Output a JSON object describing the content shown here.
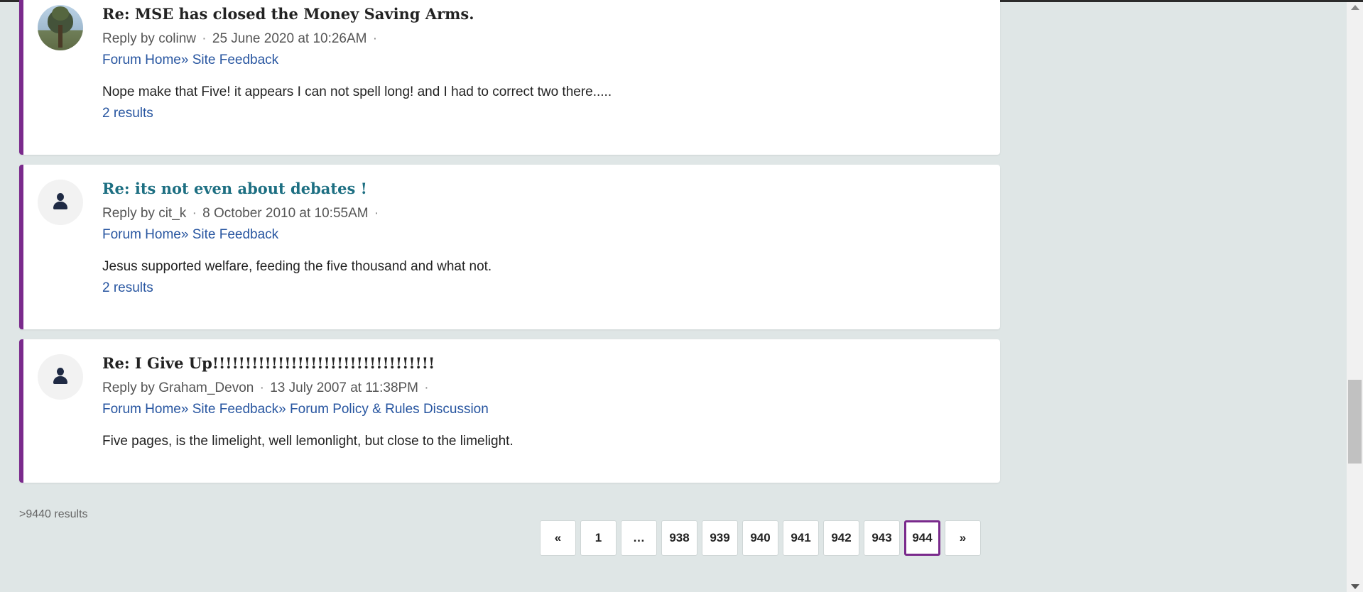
{
  "results": [
    {
      "avatar": "photo-avatar",
      "title": "Re: MSE has closed the Money Saving Arms.",
      "title_color": "#222222",
      "reply_by": "Reply by colinw",
      "date": "25 June 2020 at 10:26AM",
      "sep": "·",
      "breadcrumbs": [
        "Forum Home»",
        "Site Feedback"
      ],
      "body": "Nope make that Five! it appears I can not spell long! and I had to correct two there.....",
      "more": "2 results"
    },
    {
      "avatar": "person-icon",
      "title": "Re: its not even about debates !",
      "title_color": "#1d6f82",
      "reply_by": "Reply by cit_k",
      "date": "8 October 2010 at 10:55AM",
      "sep": "·",
      "breadcrumbs": [
        "Forum Home»",
        "Site Feedback"
      ],
      "body": "Jesus supported welfare, feeding the five thousand and what not.",
      "more": "2 results"
    },
    {
      "avatar": "person-icon",
      "title": "Re: I Give Up!!!!!!!!!!!!!!!!!!!!!!!!!!!!!!!!!!",
      "title_color": "#222222",
      "reply_by": "Reply by Graham_Devon",
      "date": "13 July 2007 at 11:38PM",
      "sep": "·",
      "breadcrumbs": [
        "Forum Home»",
        "Site Feedback»",
        "Forum Policy & Rules Discussion"
      ],
      "body": "Five pages, is the limelight, well lemonlight, but close to the limelight."
    }
  ],
  "results_count": ">9440 results",
  "pagination": {
    "prev": "«",
    "pages": [
      "1",
      "…",
      "938",
      "939",
      "940",
      "941",
      "942",
      "943",
      "944"
    ],
    "current": "944",
    "next": "»"
  },
  "colors": {
    "accent": "#7a2a8c",
    "link": "#2755a0",
    "background": "#dfe6e6"
  }
}
